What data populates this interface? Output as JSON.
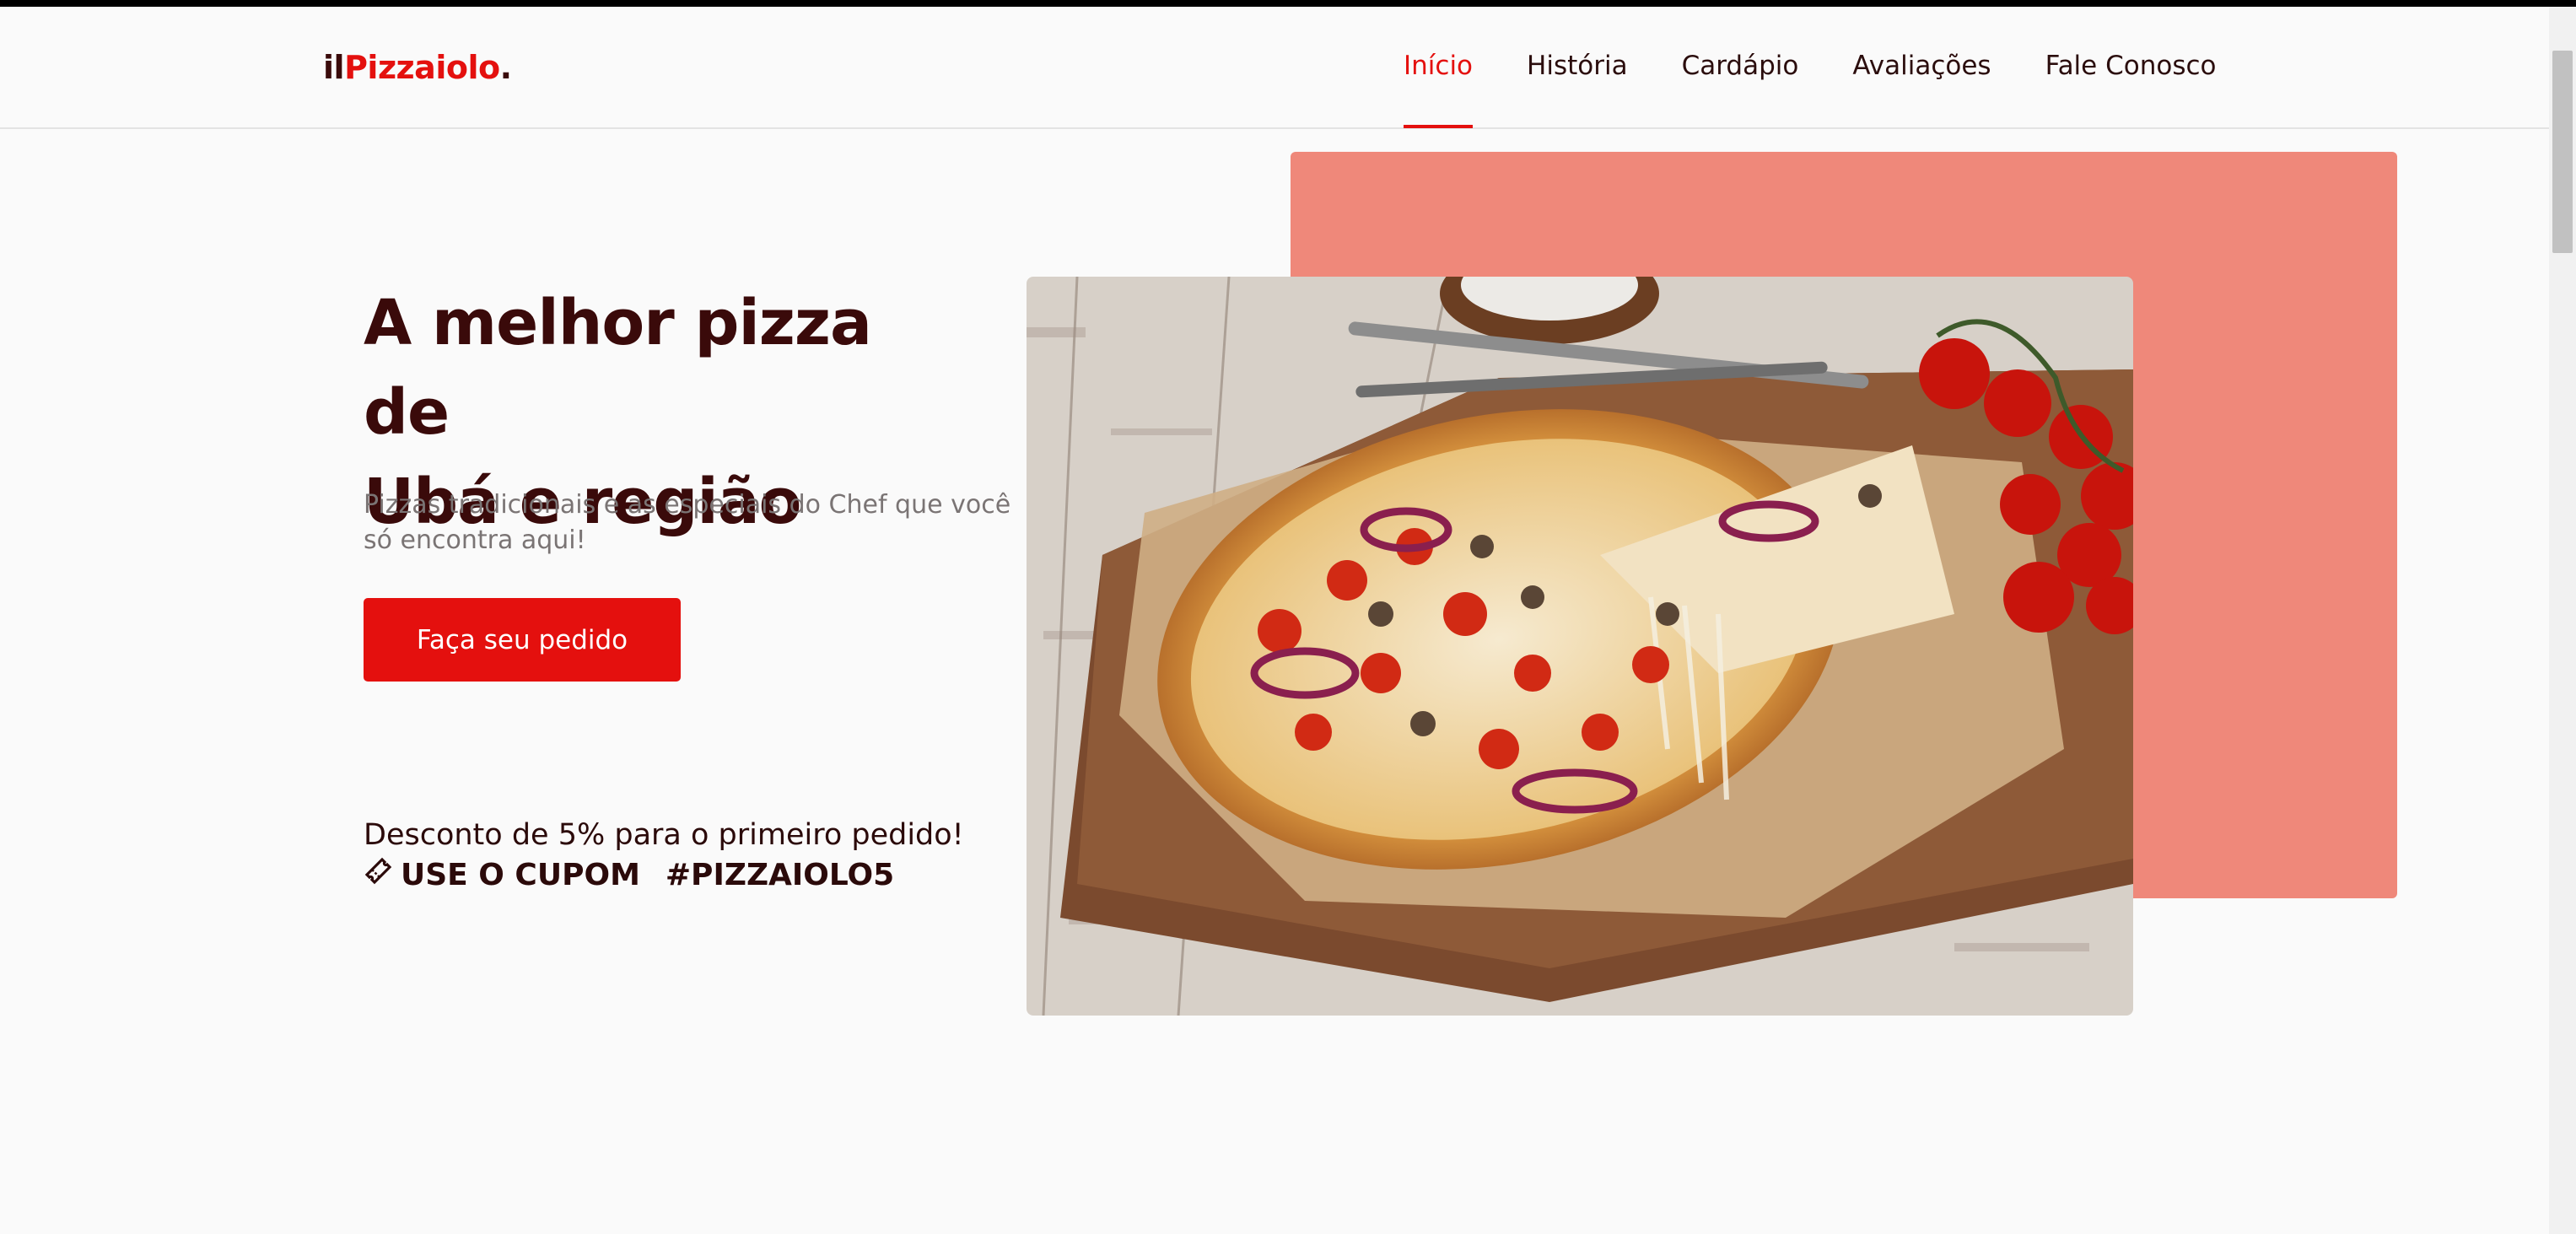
{
  "logo": {
    "prefix": "il",
    "name": "Pizzaiolo",
    "suffix": "."
  },
  "nav": {
    "items": [
      {
        "label": "Início",
        "active": true
      },
      {
        "label": "História",
        "active": false
      },
      {
        "label": "Cardápio",
        "active": false
      },
      {
        "label": "Avaliações",
        "active": false
      },
      {
        "label": "Fale Conosco",
        "active": false
      }
    ]
  },
  "hero": {
    "title_line1": "A melhor pizza de",
    "title_line2": "Ubá e região",
    "subtitle": "Pizzas tradicionais e as especiais do Chef que você só encontra aqui!",
    "cta_label": "Faça seu pedido",
    "image_icon": "pizza-photo"
  },
  "promo": {
    "discount_text": "Desconto de 5% para o primeiro pedido!",
    "coupon_label": "USE O CUPOM",
    "coupon_code": "#PIZZAIOLO5",
    "coupon_icon": "ticket-icon"
  },
  "colors": {
    "accent": "#e4100e",
    "dark": "#3a0a0a",
    "salmon": "#ef887a",
    "muted": "#7a7474"
  }
}
